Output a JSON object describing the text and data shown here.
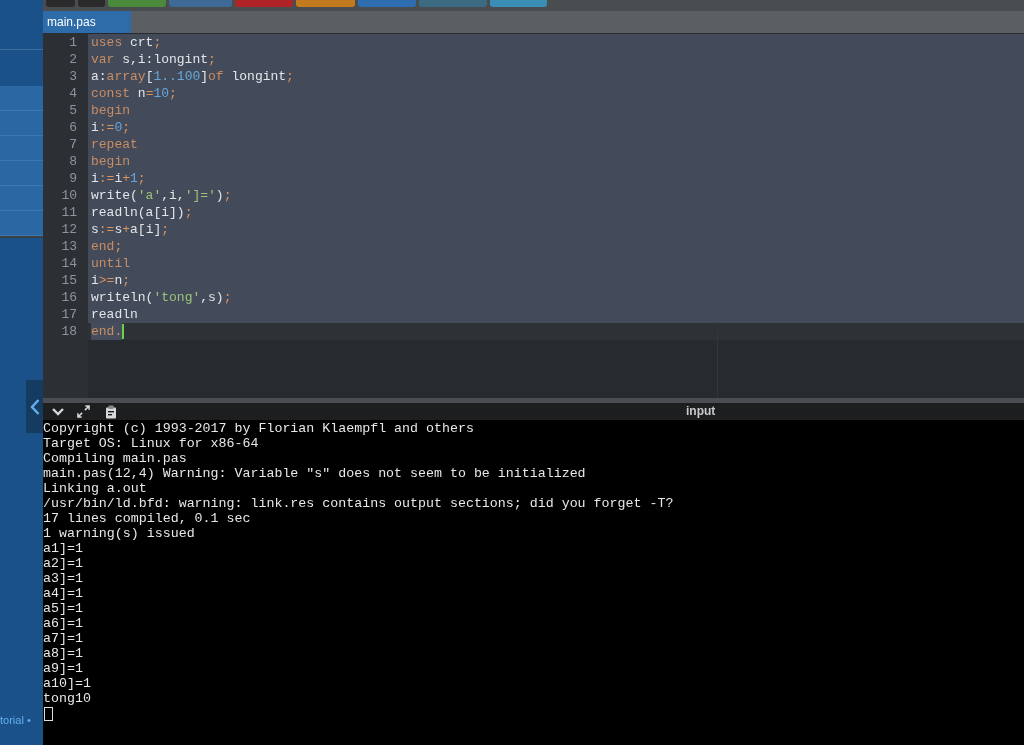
{
  "sidebar": {
    "footer": "torial •"
  },
  "toolbar_buttons": [
    {
      "color": "#2b2b2b"
    },
    {
      "color": "#2b2b2b"
    },
    {
      "color": "#4b8a3b"
    },
    {
      "color": "#3d6a96"
    },
    {
      "color": "#b02428"
    },
    {
      "color": "#c27a1f"
    },
    {
      "color": "#2d6db0"
    },
    {
      "color": "#3b6b80"
    },
    {
      "color": "#3a8db5"
    }
  ],
  "tabs": [
    {
      "label": "main.pas",
      "selected": true
    }
  ],
  "editor": {
    "lines": [
      {
        "number": "1",
        "selected": true,
        "cursor": false,
        "tokens": [
          {
            "kind": "keyword",
            "text": "uses"
          },
          {
            "kind": "plain",
            "text": " crt"
          },
          {
            "kind": "operator",
            "text": ";"
          }
        ]
      },
      {
        "number": "2",
        "selected": true,
        "cursor": false,
        "tokens": [
          {
            "kind": "keyword",
            "text": "var"
          },
          {
            "kind": "plain",
            "text": " s,i:longint"
          },
          {
            "kind": "operator",
            "text": ";"
          }
        ]
      },
      {
        "number": "3",
        "selected": true,
        "cursor": false,
        "tokens": [
          {
            "kind": "plain",
            "text": "a:"
          },
          {
            "kind": "keyword",
            "text": "array"
          },
          {
            "kind": "plain",
            "text": "["
          },
          {
            "kind": "number",
            "text": "1..100"
          },
          {
            "kind": "plain",
            "text": "]"
          },
          {
            "kind": "keyword",
            "text": "of"
          },
          {
            "kind": "plain",
            "text": " longint"
          },
          {
            "kind": "operator",
            "text": ";"
          }
        ]
      },
      {
        "number": "4",
        "selected": true,
        "cursor": false,
        "tokens": [
          {
            "kind": "keyword",
            "text": "const"
          },
          {
            "kind": "plain",
            "text": " n"
          },
          {
            "kind": "operator",
            "text": "="
          },
          {
            "kind": "number",
            "text": "10"
          },
          {
            "kind": "operator",
            "text": ";"
          }
        ]
      },
      {
        "number": "5",
        "selected": true,
        "cursor": false,
        "tokens": [
          {
            "kind": "keyword",
            "text": "begin"
          }
        ]
      },
      {
        "number": "6",
        "selected": true,
        "cursor": false,
        "tokens": [
          {
            "kind": "plain",
            "text": "i"
          },
          {
            "kind": "operator",
            "text": ":="
          },
          {
            "kind": "number",
            "text": "0"
          },
          {
            "kind": "operator",
            "text": ";"
          }
        ]
      },
      {
        "number": "7",
        "selected": true,
        "cursor": false,
        "tokens": [
          {
            "kind": "keyword",
            "text": "repeat"
          }
        ]
      },
      {
        "number": "8",
        "selected": true,
        "cursor": false,
        "tokens": [
          {
            "kind": "keyword",
            "text": "begin"
          }
        ]
      },
      {
        "number": "9",
        "selected": true,
        "cursor": false,
        "tokens": [
          {
            "kind": "plain",
            "text": "i"
          },
          {
            "kind": "operator",
            "text": ":="
          },
          {
            "kind": "plain",
            "text": "i"
          },
          {
            "kind": "operator",
            "text": "+"
          },
          {
            "kind": "number",
            "text": "1"
          },
          {
            "kind": "operator",
            "text": ";"
          }
        ]
      },
      {
        "number": "10",
        "selected": true,
        "cursor": false,
        "tokens": [
          {
            "kind": "plain",
            "text": "write("
          },
          {
            "kind": "string",
            "text": "'a'"
          },
          {
            "kind": "plain",
            "text": ",i,"
          },
          {
            "kind": "string",
            "text": "']='"
          },
          {
            "kind": "plain",
            "text": ")"
          },
          {
            "kind": "operator",
            "text": ";"
          }
        ]
      },
      {
        "number": "11",
        "selected": true,
        "cursor": false,
        "tokens": [
          {
            "kind": "plain",
            "text": "readln(a[i])"
          },
          {
            "kind": "operator",
            "text": ";"
          }
        ]
      },
      {
        "number": "12",
        "selected": true,
        "cursor": false,
        "tokens": [
          {
            "kind": "plain",
            "text": "s"
          },
          {
            "kind": "operator",
            "text": ":="
          },
          {
            "kind": "plain",
            "text": "s"
          },
          {
            "kind": "operator",
            "text": "+"
          },
          {
            "kind": "plain",
            "text": "a[i]"
          },
          {
            "kind": "operator",
            "text": ";"
          }
        ]
      },
      {
        "number": "13",
        "selected": true,
        "cursor": false,
        "tokens": [
          {
            "kind": "keyword",
            "text": "end"
          },
          {
            "kind": "operator",
            "text": ";"
          }
        ]
      },
      {
        "number": "14",
        "selected": true,
        "cursor": false,
        "tokens": [
          {
            "kind": "keyword",
            "text": "until"
          }
        ]
      },
      {
        "number": "15",
        "selected": true,
        "cursor": false,
        "tokens": [
          {
            "kind": "plain",
            "text": "i"
          },
          {
            "kind": "operator",
            "text": ">="
          },
          {
            "kind": "plain",
            "text": "n"
          },
          {
            "kind": "operator",
            "text": ";"
          }
        ]
      },
      {
        "number": "16",
        "selected": true,
        "cursor": false,
        "tokens": [
          {
            "kind": "plain",
            "text": "writeln("
          },
          {
            "kind": "string",
            "text": "'tong'"
          },
          {
            "kind": "plain",
            "text": ",s)"
          },
          {
            "kind": "operator",
            "text": ";"
          }
        ]
      },
      {
        "number": "17",
        "selected": true,
        "cursor": false,
        "tokens": [
          {
            "kind": "plain",
            "text": "readln"
          }
        ]
      },
      {
        "number": "18",
        "selected": true,
        "cursor": true,
        "tokens": [
          {
            "kind": "keyword",
            "text": "end"
          },
          {
            "kind": "operator",
            "text": "."
          }
        ]
      }
    ]
  },
  "console": {
    "label": "input",
    "lines": [
      "Copyright (c) 1993-2017 by Florian Klaempfl and others",
      "Target OS: Linux for x86-64",
      "Compiling main.pas",
      "main.pas(12,4) Warning: Variable \"s\" does not seem to be initialized",
      "Linking a.out",
      "/usr/bin/ld.bfd: warning: link.res contains output sections; did you forget -T?",
      "17 lines compiled, 0.1 sec",
      "1 warning(s) issued",
      "a1]=1",
      "a2]=1",
      "a3]=1",
      "a4]=1",
      "a5]=1",
      "a6]=1",
      "a7]=1",
      "a8]=1",
      "a9]=1",
      "a10]=1",
      "tong10"
    ],
    "cursor": true
  }
}
